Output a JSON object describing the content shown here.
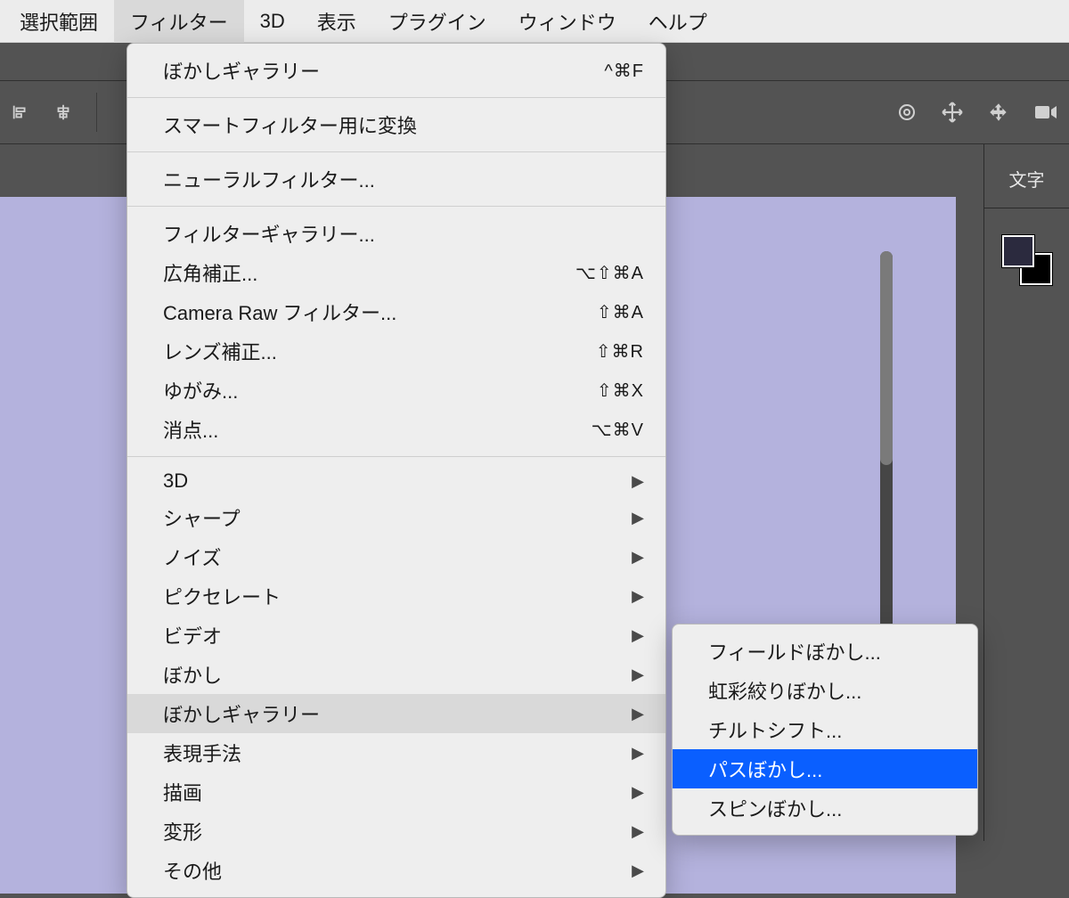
{
  "menubar": {
    "items": [
      {
        "label": "選択範囲"
      },
      {
        "label": "フィルター",
        "active": true
      },
      {
        "label": "3D"
      },
      {
        "label": "表示"
      },
      {
        "label": "プラグイン"
      },
      {
        "label": "ウィンドウ"
      },
      {
        "label": "ヘルプ"
      }
    ]
  },
  "rightPanel": {
    "tab": "文字",
    "fgColor": "#2b2a3e",
    "bgColor": "#000000"
  },
  "filterMenu": {
    "section1": [
      {
        "label": "ぼかしギャラリー",
        "shortcut": "^⌘F"
      }
    ],
    "section2": [
      {
        "label": "スマートフィルター用に変換"
      }
    ],
    "section3": [
      {
        "label": "ニューラルフィルター..."
      }
    ],
    "section4": [
      {
        "label": "フィルターギャラリー..."
      },
      {
        "label": "広角補正...",
        "shortcut": "⌥⇧⌘A"
      },
      {
        "label": "Camera Raw フィルター...",
        "shortcut": "⇧⌘A"
      },
      {
        "label": "レンズ補正...",
        "shortcut": "⇧⌘R"
      },
      {
        "label": "ゆがみ...",
        "shortcut": "⇧⌘X"
      },
      {
        "label": "消点...",
        "shortcut": "⌥⌘V"
      }
    ],
    "section5": [
      {
        "label": "3D",
        "submenu": true
      },
      {
        "label": "シャープ",
        "submenu": true
      },
      {
        "label": "ノイズ",
        "submenu": true
      },
      {
        "label": "ピクセレート",
        "submenu": true
      },
      {
        "label": "ビデオ",
        "submenu": true
      },
      {
        "label": "ぼかし",
        "submenu": true
      },
      {
        "label": "ぼかしギャラリー",
        "submenu": true,
        "hover": true
      },
      {
        "label": "表現手法",
        "submenu": true
      },
      {
        "label": "描画",
        "submenu": true
      },
      {
        "label": "変形",
        "submenu": true
      },
      {
        "label": "その他",
        "submenu": true
      }
    ]
  },
  "blurGallerySubmenu": {
    "items": [
      {
        "label": "フィールドぼかし..."
      },
      {
        "label": "虹彩絞りぼかし..."
      },
      {
        "label": "チルトシフト..."
      },
      {
        "label": "パスぼかし...",
        "selected": true
      },
      {
        "label": "スピンぼかし..."
      }
    ]
  }
}
